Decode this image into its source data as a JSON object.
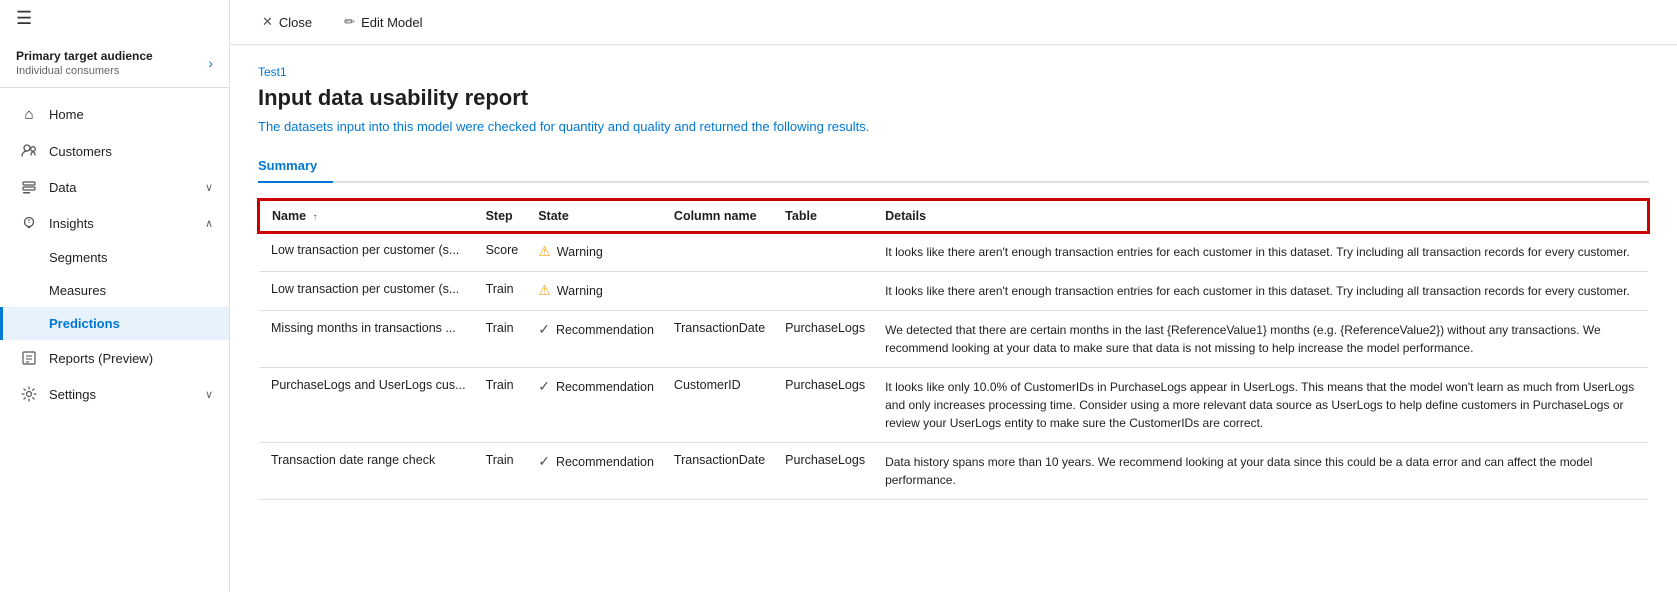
{
  "sidebar": {
    "header": {
      "title": "Primary target audience",
      "subtitle": "Individual consumers"
    },
    "hamburger_label": "☰",
    "items": [
      {
        "id": "home",
        "label": "Home",
        "icon": "⌂",
        "active": false,
        "has_sub": false
      },
      {
        "id": "customers",
        "label": "Customers",
        "icon": "👤",
        "active": false,
        "has_sub": false
      },
      {
        "id": "data",
        "label": "Data",
        "icon": "🗃",
        "active": false,
        "has_sub": true,
        "chevron": "∨"
      },
      {
        "id": "insights",
        "label": "Insights",
        "icon": "💡",
        "active": false,
        "has_sub": true,
        "chevron": "∧"
      },
      {
        "id": "segments",
        "label": "Segments",
        "icon": "",
        "sub": true
      },
      {
        "id": "measures",
        "label": "Measures",
        "icon": "",
        "sub": true
      },
      {
        "id": "predictions",
        "label": "Predictions",
        "icon": "",
        "sub": true,
        "active": true
      },
      {
        "id": "reports",
        "label": "Reports (Preview)",
        "icon": "📊",
        "active": false,
        "has_sub": false
      },
      {
        "id": "settings",
        "label": "Settings",
        "icon": "⚙",
        "active": false,
        "has_sub": true,
        "chevron": "∨"
      }
    ]
  },
  "topbar": {
    "close_label": "Close",
    "edit_model_label": "Edit Model"
  },
  "content": {
    "breadcrumb": "Test1",
    "title": "Input data usability report",
    "description": "The datasets input into this model were checked for quantity and quality and returned the following results.",
    "tab_summary": "Summary",
    "table": {
      "columns": [
        {
          "id": "name",
          "label": "Name",
          "sort": "↑"
        },
        {
          "id": "step",
          "label": "Step"
        },
        {
          "id": "state",
          "label": "State"
        },
        {
          "id": "column_name",
          "label": "Column name"
        },
        {
          "id": "table",
          "label": "Table"
        },
        {
          "id": "details",
          "label": "Details"
        }
      ],
      "rows": [
        {
          "name": "Low transaction per customer (s...",
          "step": "Score",
          "state_type": "warning",
          "state_label": "Warning",
          "column_name": "",
          "table_name": "",
          "details": "It looks like there aren't enough transaction entries for each customer in this dataset. Try including all transaction records for every customer."
        },
        {
          "name": "Low transaction per customer (s...",
          "step": "Train",
          "state_type": "warning",
          "state_label": "Warning",
          "column_name": "",
          "table_name": "",
          "details": "It looks like there aren't enough transaction entries for each customer in this dataset. Try including all transaction records for every customer."
        },
        {
          "name": "Missing months in transactions ...",
          "step": "Train",
          "state_type": "recommendation",
          "state_label": "Recommendation",
          "column_name": "TransactionDate",
          "table_name": "PurchaseLogs",
          "details": "We detected that there are certain months in the last {ReferenceValue1} months (e.g. {ReferenceValue2}) without any transactions. We recommend looking at your data to make sure that data is not missing to help increase the model performance."
        },
        {
          "name": "PurchaseLogs and UserLogs cus...",
          "step": "Train",
          "state_type": "recommendation",
          "state_label": "Recommendation",
          "column_name": "CustomerID",
          "table_name": "PurchaseLogs",
          "details": "It looks like only 10.0% of CustomerIDs in PurchaseLogs appear in UserLogs. This means that the model won't learn as much from UserLogs and only increases processing time. Consider using a more relevant data source as UserLogs to help define customers in PurchaseLogs or review your UserLogs entity to make sure the CustomerIDs are correct."
        },
        {
          "name": "Transaction date range check",
          "step": "Train",
          "state_type": "recommendation",
          "state_label": "Recommendation",
          "column_name": "TransactionDate",
          "table_name": "PurchaseLogs",
          "details": "Data history spans more than 10 years. We recommend looking at your data since this could be a data error and can affect the model performance."
        }
      ]
    }
  }
}
